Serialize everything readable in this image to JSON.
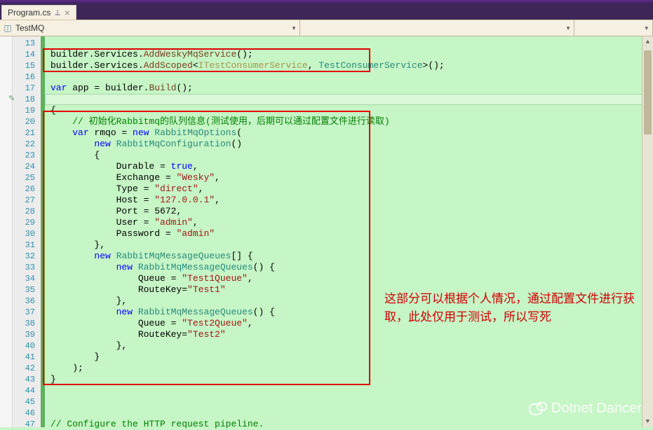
{
  "tab": {
    "title": "Program.cs",
    "pin_glyph": "⟂",
    "close_glyph": "×"
  },
  "nav": {
    "namespace": "TestMQ",
    "arrow": "▾"
  },
  "annotation": "这部分可以根据个人情况，通过配置文件进行获取，此处仅用于测试，所以写死",
  "watermark": "Dotnet Dancer",
  "lines": {
    "l13": "",
    "l14_a": "builder.Services.",
    "l14_b": "AddWeskyMqService",
    "l14_c": "();",
    "l15_a": "builder.Services.",
    "l15_b": "AddScoped",
    "l15_c": "<",
    "l15_d": "ITestConsumerService",
    "l15_e": ", ",
    "l15_f": "TestConsumerService",
    "l15_g": ">();",
    "l16": "",
    "l17_a": "var",
    "l17_b": " app = builder.",
    "l17_c": "Build",
    "l17_d": "();",
    "l18": "",
    "l19": "{",
    "l20": "    // 初始化Rabbitmq的队列信息(测试使用，后期可以通过配置文件进行读取)",
    "l21_a": "    ",
    "l21_b": "var",
    "l21_c": " rmqo = ",
    "l21_d": "new",
    "l21_e": " ",
    "l21_f": "RabbitMqOptions",
    "l21_g": "(",
    "l22_a": "        ",
    "l22_b": "new",
    "l22_c": " ",
    "l22_d": "RabbitMqConfiguration",
    "l22_e": "()",
    "l23": "        {",
    "l24_a": "            Durable = ",
    "l24_b": "true",
    "l24_c": ",",
    "l25_a": "            Exchange = ",
    "l25_b": "\"Wesky\"",
    "l25_c": ",",
    "l26_a": "            Type = ",
    "l26_b": "\"direct\"",
    "l26_c": ",",
    "l27_a": "            Host = ",
    "l27_b": "\"127.0.0.1\"",
    "l27_c": ",",
    "l28": "            Port = 5672,",
    "l29_a": "            User = ",
    "l29_b": "\"admin\"",
    "l29_c": ",",
    "l30_a": "            Password = ",
    "l30_b": "\"admin\"",
    "l31": "        },",
    "l32_a": "        ",
    "l32_b": "new",
    "l32_c": " ",
    "l32_d": "RabbitMqMessageQueues",
    "l32_e": "[] {",
    "l33_a": "            ",
    "l33_b": "new",
    "l33_c": " ",
    "l33_d": "RabbitMqMessageQueues",
    "l33_e": "() {",
    "l34_a": "                Queue = ",
    "l34_b": "\"Test1Queue\"",
    "l34_c": ",",
    "l35_a": "                RouteKey=",
    "l35_b": "\"Test1\"",
    "l36": "            },",
    "l37_a": "            ",
    "l37_b": "new",
    "l37_c": " ",
    "l37_d": "RabbitMqMessageQueues",
    "l37_e": "() {",
    "l38_a": "                Queue = ",
    "l38_b": "\"Test2Queue\"",
    "l38_c": ",",
    "l39_a": "                RouteKey=",
    "l39_b": "\"Test2\"",
    "l40": "            },",
    "l41": "        }",
    "l42": "    );",
    "l43": "}",
    "l44": "",
    "l45": "",
    "l46": "",
    "l47": "// Configure the HTTP request pipeline."
  },
  "line_numbers": [
    "13",
    "14",
    "15",
    "16",
    "17",
    "18",
    "19",
    "20",
    "21",
    "22",
    "23",
    "24",
    "25",
    "26",
    "27",
    "28",
    "29",
    "30",
    "31",
    "32",
    "33",
    "34",
    "35",
    "36",
    "37",
    "38",
    "39",
    "40",
    "41",
    "42",
    "43",
    "44",
    "45",
    "46",
    "47"
  ]
}
